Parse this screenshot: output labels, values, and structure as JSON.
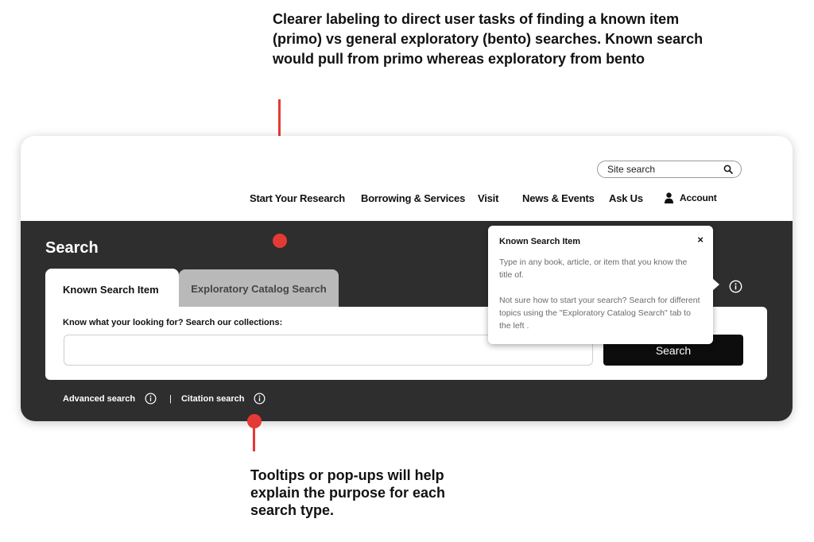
{
  "annotations": {
    "top_note": "Clearer labeling to direct user tasks of finding a known item (primo) vs general exploratory (bento) searches. Known search would pull from primo whereas exploratory from bento",
    "bottom_note": "Tooltips or pop-ups will help explain the purpose for each search type.",
    "marker_color": "#e53935"
  },
  "header": {
    "site_search_placeholder": "Site search",
    "nav": [
      {
        "label": "Start Your Research"
      },
      {
        "label": "Borrowing & Services"
      },
      {
        "label": "Visit"
      },
      {
        "label": "News & Events"
      },
      {
        "label": "Ask Us"
      }
    ],
    "account_label": "Account"
  },
  "search": {
    "heading": "Search",
    "tabs": [
      {
        "label": "Known Search Item",
        "active": true
      },
      {
        "label": "Exploratory Catalog Search",
        "active": false
      }
    ],
    "panel_label": "Know what your looking for? Search our collections:",
    "query_value": "",
    "button_label": "Search",
    "advanced_link": "Advanced search",
    "separator": "|",
    "citation_link": "Citation search"
  },
  "tooltip": {
    "title": "Known Search Item",
    "close_glyph": "×",
    "paragraph1": "Type in any book, article, or item that you know the title of.",
    "paragraph2": "Not sure how to start your search? Search for different topics using the \"Exploratory Catalog Search\" tab to the left ."
  },
  "colors": {
    "dark_band": "#2e2e2e",
    "inactive_tab": "#b9b9b9",
    "button": "#0d0d0d"
  }
}
